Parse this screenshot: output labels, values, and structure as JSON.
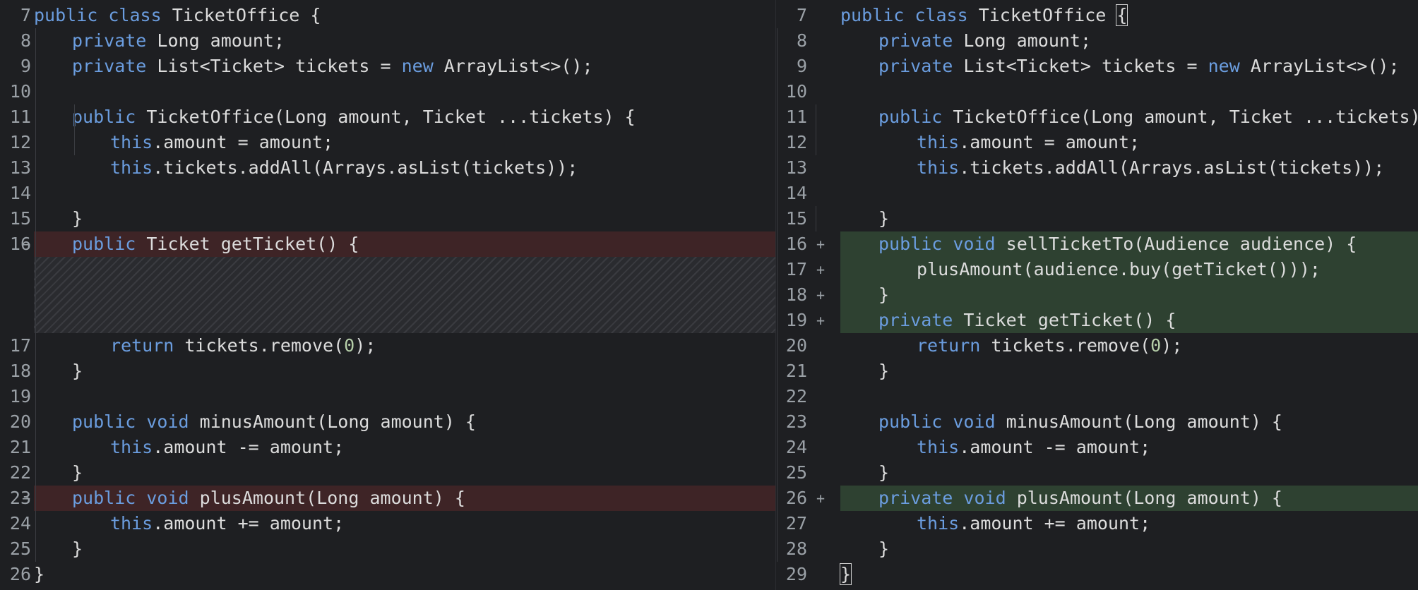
{
  "colors": {
    "background": "#1e1f22",
    "keyword": "#6b9ddf",
    "number": "#b5cea8",
    "removed_line": "#3e2426",
    "added_line": "#2e4131",
    "hatch": "#3a3b40"
  },
  "markers": {
    "removed": "−",
    "added": "+"
  },
  "left": {
    "lines": [
      {
        "num": "7",
        "indent": 0,
        "tokens": [
          {
            "t": "public",
            "c": "kw"
          },
          {
            "t": " "
          },
          {
            "t": "class",
            "c": "kw"
          },
          {
            "t": " TicketOffice {"
          }
        ]
      },
      {
        "num": "8",
        "indent": 1,
        "tokens": [
          {
            "t": "private",
            "c": "kw"
          },
          {
            "t": " Long amount;"
          }
        ]
      },
      {
        "num": "9",
        "indent": 1,
        "tokens": [
          {
            "t": "private",
            "c": "kw"
          },
          {
            "t": " List<Ticket> tickets = "
          },
          {
            "t": "new",
            "c": "kw"
          },
          {
            "t": " ArrayList<>();"
          }
        ]
      },
      {
        "num": "10",
        "indent": 0,
        "tokens": []
      },
      {
        "num": "11",
        "indent": 1,
        "tokens": [
          {
            "t": "public",
            "c": "kw"
          },
          {
            "t": " TicketOffice(Long amount, Ticket ...tickets) {"
          }
        ]
      },
      {
        "num": "12",
        "indent": 2,
        "tokens": [
          {
            "t": "this",
            "c": "kw"
          },
          {
            "t": ".amount = amount;"
          }
        ]
      },
      {
        "num": "13",
        "indent": 2,
        "tokens": [
          {
            "t": "this",
            "c": "kw"
          },
          {
            "t": ".tickets.addAll(Arrays.asList(tickets));"
          }
        ]
      },
      {
        "num": "14",
        "indent": 0,
        "tokens": []
      },
      {
        "num": "15",
        "indent": 1,
        "tokens": [
          {
            "t": "}"
          }
        ]
      },
      {
        "num": "16",
        "indent": 1,
        "status": "removed",
        "tokens": [
          {
            "t": "public",
            "c": "kw"
          },
          {
            "t": " Ticket getTicket() {"
          }
        ]
      },
      {
        "hatch": true
      },
      {
        "num": "17",
        "indent": 2,
        "tokens": [
          {
            "t": "return",
            "c": "kw"
          },
          {
            "t": " tickets.remove("
          },
          {
            "t": "0",
            "c": "num"
          },
          {
            "t": ");"
          }
        ]
      },
      {
        "num": "18",
        "indent": 1,
        "tokens": [
          {
            "t": "}"
          }
        ]
      },
      {
        "num": "19",
        "indent": 0,
        "tokens": []
      },
      {
        "num": "20",
        "indent": 1,
        "tokens": [
          {
            "t": "public",
            "c": "kw"
          },
          {
            "t": " "
          },
          {
            "t": "void",
            "c": "kw"
          },
          {
            "t": " minusAmount(Long amount) {"
          }
        ]
      },
      {
        "num": "21",
        "indent": 2,
        "tokens": [
          {
            "t": "this",
            "c": "kw"
          },
          {
            "t": ".amount -= amount;"
          }
        ]
      },
      {
        "num": "22",
        "indent": 1,
        "tokens": [
          {
            "t": "}"
          }
        ]
      },
      {
        "num": "23",
        "indent": 1,
        "status": "removed",
        "tokens": [
          {
            "t": "public",
            "c": "kw"
          },
          {
            "t": " "
          },
          {
            "t": "void",
            "c": "kw"
          },
          {
            "t": " plusAmount(Long amount) {"
          }
        ]
      },
      {
        "num": "24",
        "indent": 2,
        "tokens": [
          {
            "t": "this",
            "c": "kw"
          },
          {
            "t": ".amount += amount;"
          }
        ]
      },
      {
        "num": "25",
        "indent": 1,
        "tokens": [
          {
            "t": "}"
          }
        ]
      },
      {
        "num": "26",
        "indent": 0,
        "tokens": [
          {
            "t": "}"
          }
        ]
      }
    ]
  },
  "right": {
    "lines": [
      {
        "num": "7",
        "indent": 0,
        "tokens": [
          {
            "t": "public",
            "c": "kw"
          },
          {
            "t": " "
          },
          {
            "t": "class",
            "c": "kw"
          },
          {
            "t": " TicketOffice "
          },
          {
            "t": "{",
            "c": "bracket-hl"
          }
        ]
      },
      {
        "num": "8",
        "indent": 1,
        "tokens": [
          {
            "t": "private",
            "c": "kw"
          },
          {
            "t": " Long amount;"
          }
        ]
      },
      {
        "num": "9",
        "indent": 1,
        "tokens": [
          {
            "t": "private",
            "c": "kw"
          },
          {
            "t": " List<Ticket> tickets = "
          },
          {
            "t": "new",
            "c": "kw"
          },
          {
            "t": " ArrayList<>();"
          }
        ]
      },
      {
        "num": "10",
        "indent": 0,
        "tokens": []
      },
      {
        "num": "11",
        "indent": 1,
        "tokens": [
          {
            "t": "public",
            "c": "kw"
          },
          {
            "t": " TicketOffice(Long amount, Ticket ...tickets) {"
          }
        ]
      },
      {
        "num": "12",
        "indent": 2,
        "tokens": [
          {
            "t": "this",
            "c": "kw"
          },
          {
            "t": ".amount = amount;"
          }
        ]
      },
      {
        "num": "13",
        "indent": 2,
        "tokens": [
          {
            "t": "this",
            "c": "kw"
          },
          {
            "t": ".tickets.addAll(Arrays.asList(tickets));"
          }
        ]
      },
      {
        "num": "14",
        "indent": 0,
        "tokens": []
      },
      {
        "num": "15",
        "indent": 1,
        "tokens": [
          {
            "t": "}"
          }
        ]
      },
      {
        "num": "16",
        "indent": 1,
        "status": "added",
        "tokens": [
          {
            "t": "public",
            "c": "kw"
          },
          {
            "t": " "
          },
          {
            "t": "void",
            "c": "kw"
          },
          {
            "t": " sellTicketTo(Audience audience) {"
          }
        ]
      },
      {
        "num": "17",
        "indent": 2,
        "status": "added",
        "tokens": [
          {
            "t": "plusAmount(audience.buy(getTicket()));"
          }
        ]
      },
      {
        "num": "18",
        "indent": 1,
        "status": "added",
        "tokens": [
          {
            "t": "}"
          }
        ]
      },
      {
        "num": "19",
        "indent": 1,
        "status": "added",
        "tokens": [
          {
            "t": "private",
            "c": "kw"
          },
          {
            "t": " Ticket getTicket() {"
          }
        ]
      },
      {
        "num": "20",
        "indent": 2,
        "tokens": [
          {
            "t": "return",
            "c": "kw"
          },
          {
            "t": " tickets.remove("
          },
          {
            "t": "0",
            "c": "num"
          },
          {
            "t": ");"
          }
        ]
      },
      {
        "num": "21",
        "indent": 1,
        "tokens": [
          {
            "t": "}"
          }
        ]
      },
      {
        "num": "22",
        "indent": 0,
        "tokens": []
      },
      {
        "num": "23",
        "indent": 1,
        "tokens": [
          {
            "t": "public",
            "c": "kw"
          },
          {
            "t": " "
          },
          {
            "t": "void",
            "c": "kw"
          },
          {
            "t": " minusAmount(Long amount) {"
          }
        ]
      },
      {
        "num": "24",
        "indent": 2,
        "tokens": [
          {
            "t": "this",
            "c": "kw"
          },
          {
            "t": ".amount -= amount;"
          }
        ]
      },
      {
        "num": "25",
        "indent": 1,
        "tokens": [
          {
            "t": "}"
          }
        ]
      },
      {
        "num": "26",
        "indent": 1,
        "status": "added",
        "tokens": [
          {
            "t": "private",
            "c": "kw"
          },
          {
            "t": " "
          },
          {
            "t": "void",
            "c": "kw"
          },
          {
            "t": " plusAmount(Long amount) {"
          }
        ]
      },
      {
        "num": "27",
        "indent": 2,
        "tokens": [
          {
            "t": "this",
            "c": "kw"
          },
          {
            "t": ".amount += amount;"
          }
        ]
      },
      {
        "num": "28",
        "indent": 1,
        "tokens": [
          {
            "t": "}"
          }
        ]
      },
      {
        "num": "29",
        "indent": 0,
        "tokens": [
          {
            "t": "}",
            "c": "bracket-hl"
          }
        ]
      }
    ]
  }
}
